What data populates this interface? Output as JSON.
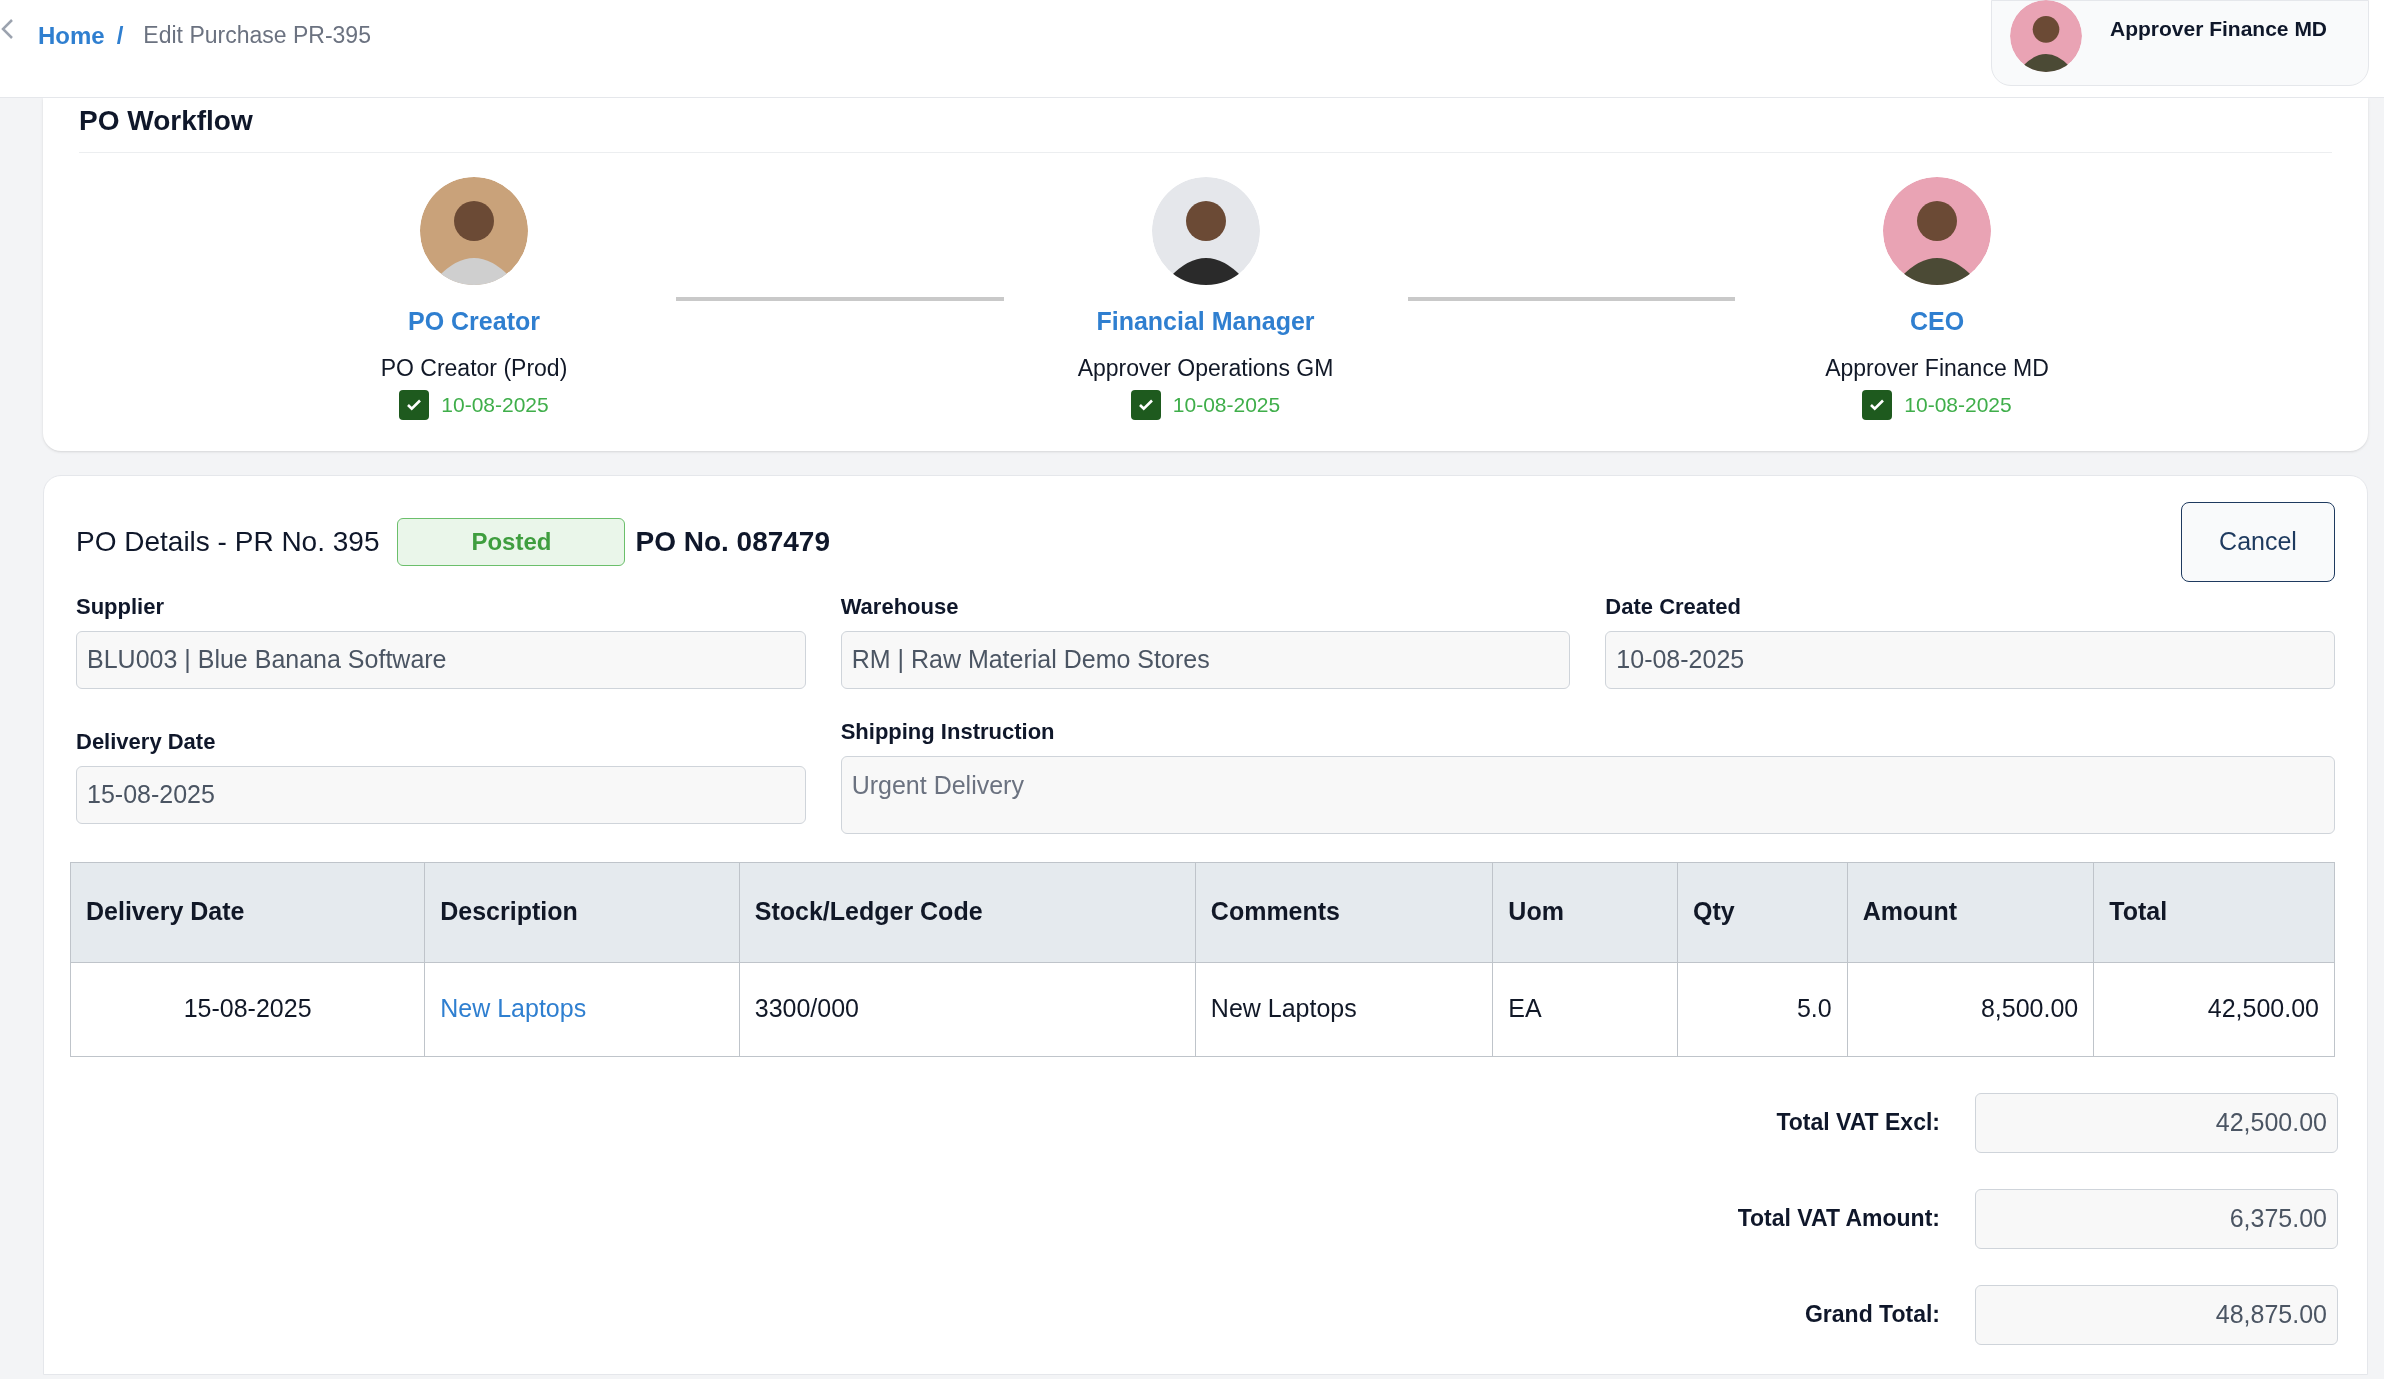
{
  "breadcrumb": {
    "home": "Home",
    "separator": "/",
    "current": "Edit Purchase PR-395"
  },
  "user": {
    "name": "Approver Finance MD"
  },
  "workflow": {
    "title": "PO Workflow",
    "steps": [
      {
        "role": "PO Creator",
        "name": "PO Creator (Prod)",
        "approved": true,
        "date": "10-08-2025"
      },
      {
        "role": "Financial Manager",
        "name": "Approver Operations GM",
        "approved": true,
        "date": "10-08-2025"
      },
      {
        "role": "CEO",
        "name": "Approver Finance MD",
        "approved": true,
        "date": "10-08-2025"
      }
    ]
  },
  "details": {
    "title": "PO Details - PR No. 395",
    "status": "Posted",
    "po_number": "PO No. 087479",
    "cancel": "Cancel",
    "fields": [
      {
        "label": "Supplier",
        "value": "BLU003 | Blue Banana Software"
      },
      {
        "label": "Warehouse",
        "value": "RM | Raw Material Demo Stores"
      },
      {
        "label": "Date Created",
        "value": "10-08-2025"
      },
      {
        "label": "Delivery Date",
        "value": "15-08-2025"
      }
    ],
    "shipping": {
      "label": "Shipping Instruction",
      "value": "Urgent Delivery"
    }
  },
  "table": {
    "columns": [
      "Delivery Date",
      "Description",
      "Stock/Ledger Code",
      "Comments",
      "Uom",
      "Qty",
      "Amount",
      "Total"
    ],
    "rows": [
      {
        "delivery_date": "15-08-2025",
        "description": "New Laptops",
        "code": "3300/000",
        "comments": "New Laptops",
        "uom": "EA",
        "qty": "5.0",
        "amount": "8,500.00",
        "total": "42,500.00"
      }
    ]
  },
  "totals": [
    {
      "label": "Total VAT Excl:",
      "value": "42,500.00"
    },
    {
      "label": "Total VAT Amount:",
      "value": "6,375.00"
    },
    {
      "label": "Grand Total:",
      "value": "48,875.00"
    }
  ]
}
